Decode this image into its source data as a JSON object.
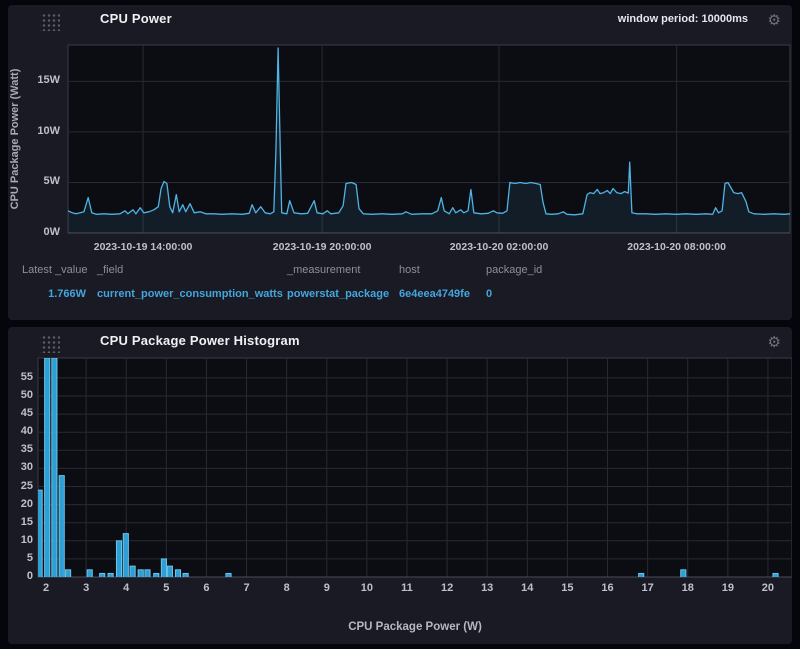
{
  "colors": {
    "page_bg": "#05060b",
    "panel_bg": "#191a23",
    "plot_bg": "#0c0d13",
    "grid": "#282935",
    "plot_border": "#3a3b47",
    "axis_line": "#4a4b57",
    "tick_text": "#bdc0cb",
    "line": "#4fb3e3",
    "line_fill": "rgba(79,179,227,0.10)",
    "bar_fill": "#2e9fd4",
    "bar_stroke": "#74c8ee",
    "legend_value_text": "#43a5dc",
    "legend_header_text": "#8d8f9d"
  },
  "icons": {
    "gear": "⚙"
  },
  "panel1": {
    "title": "CPU Power",
    "window_period": "window period: 10000ms",
    "legend_columns": [
      {
        "header": "Latest _value",
        "value": "1.766W"
      },
      {
        "header": "_field",
        "value": "current_power_consumption_watts"
      },
      {
        "header": "_measurement",
        "value": "powerstat_package"
      },
      {
        "header": "host",
        "value": "6e4eea4749fe"
      },
      {
        "header": "package_id",
        "value": "0"
      }
    ]
  },
  "panel2": {
    "title": "CPU Package Power Histogram"
  },
  "chart_data": [
    {
      "type": "line",
      "title": "CPU Power",
      "ylabel": "CPU Package Power (Watt)",
      "xlabel": "",
      "ylim": [
        0,
        18.6
      ],
      "grid": true,
      "legend_position": "below",
      "y_ticks": [
        {
          "value": 0,
          "label": "0W"
        },
        {
          "value": 5,
          "label": "5W"
        },
        {
          "value": 10,
          "label": "10W"
        },
        {
          "value": 15,
          "label": "15W"
        }
      ],
      "x_ticks": [
        {
          "frac": 0.104,
          "label": "2023-10-19 14:00:00"
        },
        {
          "frac": 0.352,
          "label": "2023-10-19 20:00:00"
        },
        {
          "frac": 0.597,
          "label": "2023-10-20 02:00:00"
        },
        {
          "frac": 0.843,
          "label": "2023-10-20 08:00:00"
        }
      ],
      "series": [
        {
          "name": "current_power_consumption_watts",
          "latest_value": "1.766W",
          "points": [
            [
              0.0,
              2.2
            ],
            [
              0.006,
              2.0
            ],
            [
              0.011,
              1.9
            ],
            [
              0.017,
              2.0
            ],
            [
              0.022,
              2.1
            ],
            [
              0.028,
              3.5
            ],
            [
              0.033,
              2.0
            ],
            [
              0.039,
              1.85
            ],
            [
              0.05,
              1.9
            ],
            [
              0.061,
              1.85
            ],
            [
              0.072,
              1.9
            ],
            [
              0.079,
              2.2
            ],
            [
              0.083,
              1.9
            ],
            [
              0.09,
              2.3
            ],
            [
              0.094,
              1.9
            ],
            [
              0.1,
              2.5
            ],
            [
              0.105,
              2.0
            ],
            [
              0.112,
              2.1
            ],
            [
              0.119,
              2.3
            ],
            [
              0.125,
              2.6
            ],
            [
              0.129,
              4.4
            ],
            [
              0.133,
              5.1
            ],
            [
              0.137,
              4.9
            ],
            [
              0.141,
              2.6
            ],
            [
              0.145,
              2.0
            ],
            [
              0.15,
              3.8
            ],
            [
              0.154,
              2.1
            ],
            [
              0.159,
              2.8
            ],
            [
              0.163,
              2.1
            ],
            [
              0.169,
              2.9
            ],
            [
              0.175,
              2.0
            ],
            [
              0.183,
              2.1
            ],
            [
              0.191,
              1.9
            ],
            [
              0.202,
              1.9
            ],
            [
              0.213,
              1.85
            ],
            [
              0.227,
              1.9
            ],
            [
              0.241,
              1.85
            ],
            [
              0.251,
              1.95
            ],
            [
              0.255,
              2.8
            ],
            [
              0.26,
              2.0
            ],
            [
              0.267,
              2.6
            ],
            [
              0.273,
              2.0
            ],
            [
              0.28,
              1.9
            ],
            [
              0.285,
              2.1
            ],
            [
              0.288,
              8.0
            ],
            [
              0.291,
              18.3
            ],
            [
              0.294,
              8.0
            ],
            [
              0.296,
              2.0
            ],
            [
              0.303,
              1.9
            ],
            [
              0.307,
              3.2
            ],
            [
              0.313,
              2.0
            ],
            [
              0.323,
              1.9
            ],
            [
              0.332,
              1.95
            ],
            [
              0.341,
              3.2
            ],
            [
              0.345,
              2.0
            ],
            [
              0.353,
              1.9
            ],
            [
              0.359,
              2.2
            ],
            [
              0.364,
              1.9
            ],
            [
              0.375,
              2.0
            ],
            [
              0.381,
              2.7
            ],
            [
              0.385,
              4.9
            ],
            [
              0.393,
              5.0
            ],
            [
              0.399,
              4.8
            ],
            [
              0.403,
              2.4
            ],
            [
              0.409,
              1.9
            ],
            [
              0.421,
              1.85
            ],
            [
              0.435,
              1.9
            ],
            [
              0.449,
              1.85
            ],
            [
              0.463,
              1.9
            ],
            [
              0.468,
              2.1
            ],
            [
              0.476,
              1.85
            ],
            [
              0.49,
              1.9
            ],
            [
              0.504,
              1.9
            ],
            [
              0.512,
              2.2
            ],
            [
              0.517,
              3.5
            ],
            [
              0.521,
              2.2
            ],
            [
              0.528,
              1.9
            ],
            [
              0.533,
              2.5
            ],
            [
              0.537,
              2.0
            ],
            [
              0.544,
              2.3
            ],
            [
              0.548,
              2.0
            ],
            [
              0.554,
              2.2
            ],
            [
              0.558,
              4.3
            ],
            [
              0.562,
              2.0
            ],
            [
              0.572,
              1.9
            ],
            [
              0.582,
              1.95
            ],
            [
              0.589,
              2.2
            ],
            [
              0.594,
              2.0
            ],
            [
              0.602,
              1.95
            ],
            [
              0.608,
              2.2
            ],
            [
              0.612,
              5.0
            ],
            [
              0.619,
              4.9
            ],
            [
              0.626,
              5.0
            ],
            [
              0.634,
              4.9
            ],
            [
              0.641,
              5.0
            ],
            [
              0.648,
              4.9
            ],
            [
              0.654,
              4.8
            ],
            [
              0.658,
              3.0
            ],
            [
              0.662,
              1.9
            ],
            [
              0.67,
              1.85
            ],
            [
              0.679,
              1.9
            ],
            [
              0.686,
              2.1
            ],
            [
              0.691,
              1.85
            ],
            [
              0.702,
              1.8
            ],
            [
              0.713,
              1.9
            ],
            [
              0.719,
              3.8
            ],
            [
              0.723,
              4.0
            ],
            [
              0.728,
              3.9
            ],
            [
              0.733,
              4.3
            ],
            [
              0.737,
              3.9
            ],
            [
              0.742,
              4.0
            ],
            [
              0.747,
              4.2
            ],
            [
              0.751,
              3.9
            ],
            [
              0.755,
              4.4
            ],
            [
              0.76,
              4.0
            ],
            [
              0.766,
              3.9
            ],
            [
              0.771,
              4.1
            ],
            [
              0.776,
              3.95
            ],
            [
              0.778,
              7.0
            ],
            [
              0.781,
              2.0
            ],
            [
              0.788,
              1.9
            ],
            [
              0.8,
              1.9
            ],
            [
              0.814,
              1.85
            ],
            [
              0.828,
              1.9
            ],
            [
              0.842,
              1.85
            ],
            [
              0.856,
              1.9
            ],
            [
              0.87,
              1.85
            ],
            [
              0.884,
              1.9
            ],
            [
              0.893,
              1.85
            ],
            [
              0.897,
              2.5
            ],
            [
              0.901,
              2.0
            ],
            [
              0.906,
              2.2
            ],
            [
              0.91,
              4.9
            ],
            [
              0.914,
              5.0
            ],
            [
              0.918,
              4.5
            ],
            [
              0.922,
              4.0
            ],
            [
              0.928,
              3.9
            ],
            [
              0.933,
              4.0
            ],
            [
              0.939,
              3.1
            ],
            [
              0.943,
              2.1
            ],
            [
              0.95,
              1.9
            ],
            [
              0.964,
              1.85
            ],
            [
              0.978,
              1.9
            ],
            [
              0.992,
              1.85
            ],
            [
              1.0,
              1.9
            ]
          ]
        }
      ]
    },
    {
      "type": "bar",
      "title": "CPU Package Power Histogram",
      "xlabel": "CPU Package Power (W)",
      "ylabel": "",
      "xlim": [
        1.8,
        20.6
      ],
      "ylim": [
        0,
        60.5
      ],
      "grid": true,
      "bar_width": 0.15,
      "x_ticks": [
        2,
        3,
        4,
        5,
        6,
        7,
        8,
        9,
        10,
        11,
        12,
        13,
        14,
        15,
        16,
        17,
        18,
        19,
        20
      ],
      "y_ticks": [
        0,
        5,
        10,
        15,
        20,
        25,
        30,
        35,
        40,
        45,
        50,
        55
      ],
      "bars": [
        [
          1.85,
          24
        ],
        [
          2.04,
          60.5
        ],
        [
          2.22,
          60.5
        ],
        [
          2.4,
          28
        ],
        [
          2.56,
          2
        ],
        [
          3.1,
          2
        ],
        [
          3.41,
          1
        ],
        [
          3.62,
          1
        ],
        [
          3.83,
          10
        ],
        [
          4.0,
          12
        ],
        [
          4.17,
          3
        ],
        [
          4.37,
          2
        ],
        [
          4.54,
          2
        ],
        [
          4.76,
          1
        ],
        [
          4.95,
          5
        ],
        [
          5.1,
          3
        ],
        [
          5.3,
          2
        ],
        [
          5.49,
          1
        ],
        [
          6.56,
          1
        ],
        [
          16.85,
          1
        ],
        [
          17.9,
          2
        ],
        [
          20.2,
          1
        ]
      ]
    }
  ]
}
